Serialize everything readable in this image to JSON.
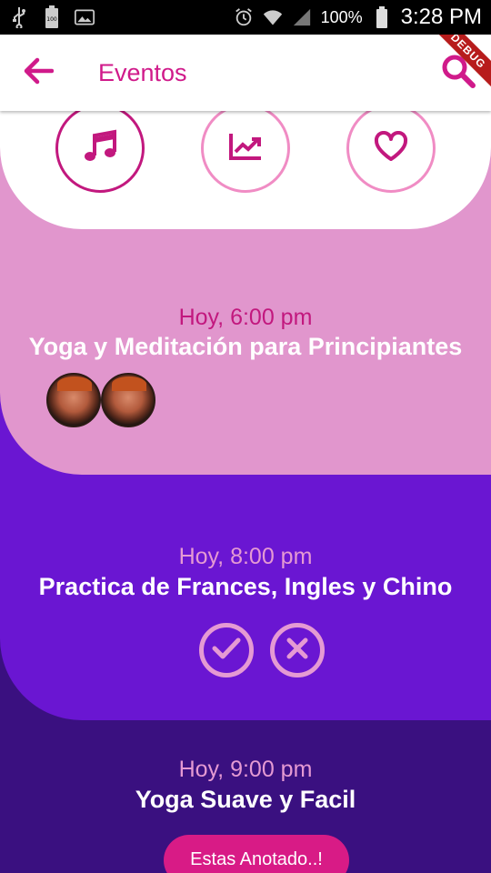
{
  "status_bar": {
    "battery_text": "100%",
    "time": "3:28 PM",
    "battery_small": "100"
  },
  "app_bar": {
    "title": "Eventos",
    "debug_ribbon": "DEBUG"
  },
  "colors": {
    "accent": "#d01a8a",
    "pink_card": "#e196cd",
    "purple_card": "#6a16d2",
    "dark_card": "#3a1080",
    "action_ring": "#e59ad3"
  },
  "categories": [
    {
      "icon": "music-note-icon",
      "active": true
    },
    {
      "icon": "trending-up-icon",
      "active": false
    },
    {
      "icon": "heart-icon",
      "active": false
    }
  ],
  "events": [
    {
      "time": "Hoy, 6:00 pm",
      "title": "Yoga y Meditación para Principiantes"
    },
    {
      "time": "Hoy, 8:00 pm",
      "title": "Practica de Frances, Ingles y Chino"
    },
    {
      "time": "Hoy, 9:00 pm",
      "title": "Yoga Suave y Facil",
      "button": "Estas Anotado..!"
    }
  ]
}
